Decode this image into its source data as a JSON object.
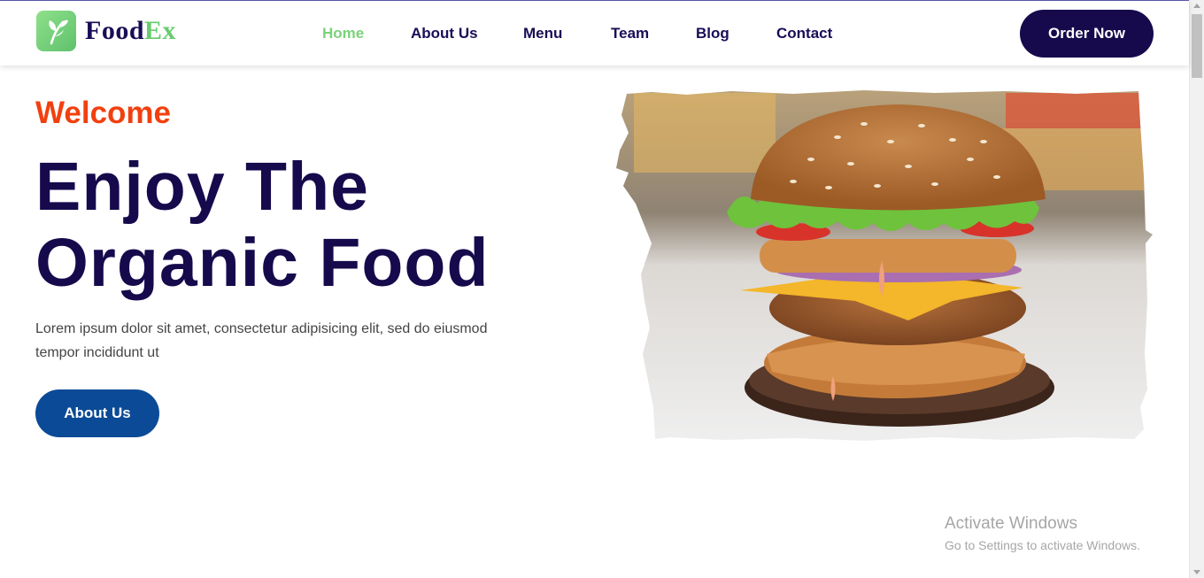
{
  "brand": {
    "name_part1": "Food",
    "name_part2": "Ex",
    "logo_icon": "leaf-icon",
    "accent": "#69cc6f",
    "primary": "#160a4c"
  },
  "nav": {
    "items": [
      {
        "label": "Home",
        "active": true
      },
      {
        "label": "About Us",
        "active": false
      },
      {
        "label": "Menu",
        "active": false
      },
      {
        "label": "Team",
        "active": false
      },
      {
        "label": "Blog",
        "active": false
      },
      {
        "label": "Contact",
        "active": false
      }
    ],
    "cta_label": "Order Now"
  },
  "hero": {
    "eyebrow": "Welcome",
    "title_line1": "Enjoy The",
    "title_line2": "Organic Food",
    "description_line1": "Lorem ipsum dolor sit amet, consectetur adipisicing elit, sed do eiusmod",
    "description_line2": "tempor incididunt ut",
    "button_label": "About Us",
    "image": "burger-photo",
    "eyebrow_color": "#f1400f",
    "button_color": "#0b4a96"
  },
  "os_overlay": {
    "title": "Activate Windows",
    "subtitle": "Go to Settings to activate Windows."
  }
}
